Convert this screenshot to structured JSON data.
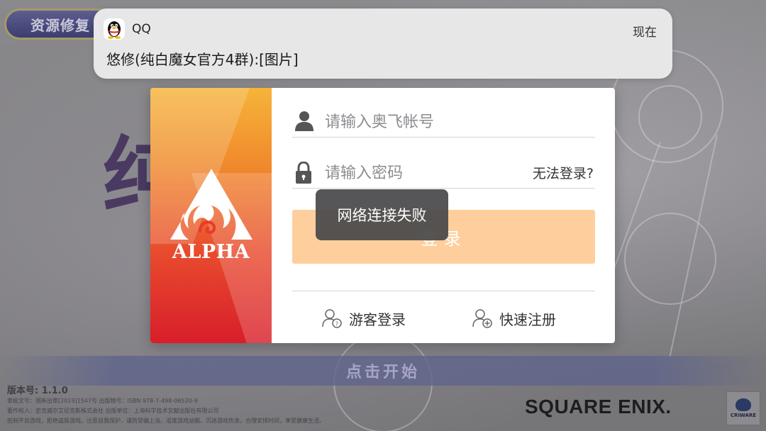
{
  "background": {
    "repair_button_label": "资源修复",
    "title_glyph": "纯",
    "start_label": "点击开始",
    "version_text": "版本号: 1.1.0",
    "legal_lines": [
      "审批文号：国新出审[2019]1547号 出版物号：ISBN 978-7-498-06520-9",
      "著作权人：史克威尔艾尼克斯株式会社 出版单位：上海科学技术文献出版社有限公司",
      "抵制不良游戏，拒绝盗版游戏。注意自我保护，谨防受骗上当。适度游戏益脑，沉迷游戏伤身。合理安排时间，享受健康生活。"
    ],
    "publisher_logo": "SQUARE ENIX.",
    "middleware_logo": "CRIWARE"
  },
  "notification": {
    "app_icon": "qq-penguin-icon",
    "app_name": "QQ",
    "time": "现在",
    "message": "悠修(纯白魔女官方4群):[图片]"
  },
  "login_dialog": {
    "brand_name": "ALPHA",
    "account_placeholder": "请输入奥飞帐号",
    "account_value": "",
    "password_placeholder": "请输入密码",
    "password_value": "",
    "forgot_label": "无法登录?",
    "login_label": "登录",
    "guest_login_label": "游客登录",
    "quick_register_label": "快速注册",
    "accent_color": "#fecf9c"
  },
  "toast": {
    "message": "网络连接失败"
  }
}
